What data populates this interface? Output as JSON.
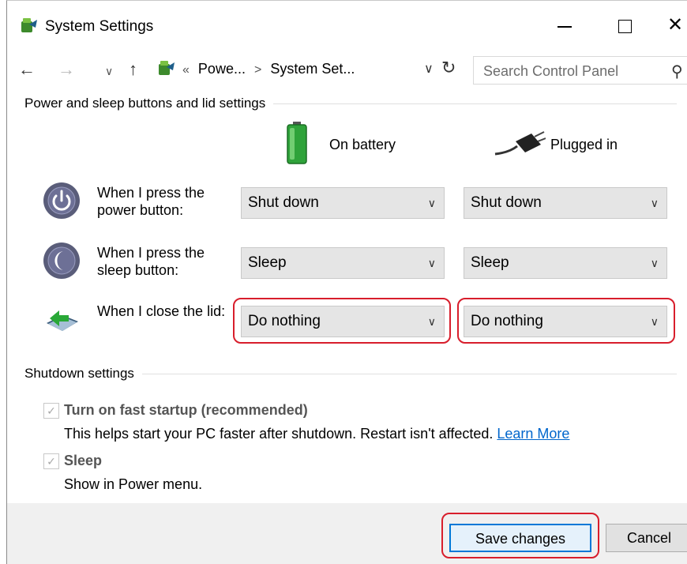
{
  "window": {
    "title": "System Settings"
  },
  "nav": {
    "breadcrumb_prefix": "«",
    "breadcrumb": [
      "Powe...",
      "System Set..."
    ],
    "breadcrumb_sep": ">",
    "search_placeholder": "Search Control Panel"
  },
  "power_section": {
    "header": "Power and sleep buttons and lid settings",
    "col_battery": "On battery",
    "col_plugged": "Plugged in",
    "rows": [
      {
        "label": "When I press the power button:",
        "battery": "Shut down",
        "plugged": "Shut down"
      },
      {
        "label": "When I press the sleep button:",
        "battery": "Sleep",
        "plugged": "Sleep"
      },
      {
        "label": "When I close the lid:",
        "battery": "Do nothing",
        "plugged": "Do nothing"
      }
    ]
  },
  "shutdown_section": {
    "header": "Shutdown settings",
    "fast_startup": {
      "label": "Turn on fast startup (recommended)",
      "checked": true,
      "description": "This helps start your PC faster after shutdown. Restart isn't affected.",
      "link": "Learn More"
    },
    "sleep": {
      "label": "Sleep",
      "checked": true,
      "description": "Show in Power menu."
    }
  },
  "buttons": {
    "save": "Save changes",
    "cancel": "Cancel"
  },
  "colors": {
    "highlight": "#d81e2c",
    "link": "#0066cc",
    "accent": "#0078d7"
  }
}
